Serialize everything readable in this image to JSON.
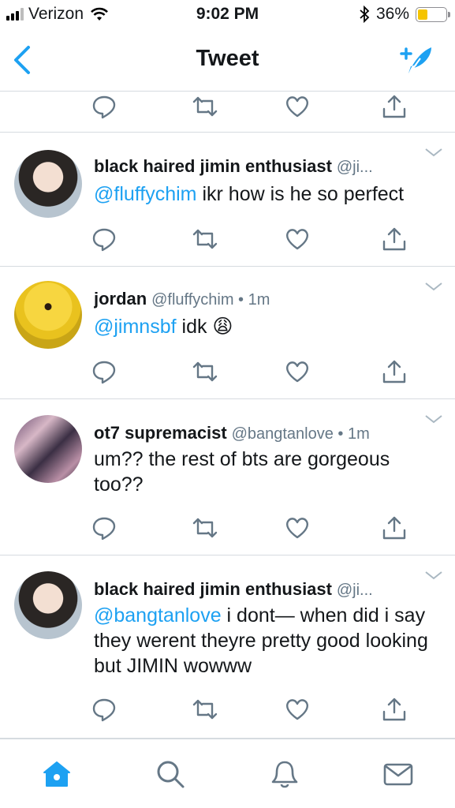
{
  "status": {
    "carrier": "Verizon",
    "time": "9:02 PM",
    "battery": "36%",
    "battery_level": 0.36
  },
  "nav": {
    "title": "Tweet"
  },
  "tweets": [
    {
      "name": "black haired jimin enthusiast",
      "handle": "@ji...",
      "mention": "@fluffychim",
      "text": " ikr how is he so perfect"
    },
    {
      "name": "jordan",
      "handle": "@fluffychim • 1m",
      "mention": "@jimnsbf",
      "text": " idk 😩"
    },
    {
      "name": "ot7 supremacist",
      "handle": "@bangtanlove • 1m",
      "mention": "",
      "text": "um?? the rest of bts are gorgeous too??"
    },
    {
      "name": "black haired jimin enthusiast",
      "handle": "@ji...",
      "mention": "@bangtanlove",
      "text": " i dont— when did i say they werent theyre pretty good looking but JIMIN wowww"
    }
  ],
  "icons": {
    "reply": "reply-icon",
    "retweet": "retweet-icon",
    "like": "heart-icon",
    "share": "share-icon",
    "home": "home-icon",
    "search": "search-icon",
    "notifications": "bell-icon",
    "messages": "mail-icon"
  },
  "colors": {
    "accent": "#1da1f2",
    "action_gray": "#657786",
    "battery": "#f5c400"
  }
}
